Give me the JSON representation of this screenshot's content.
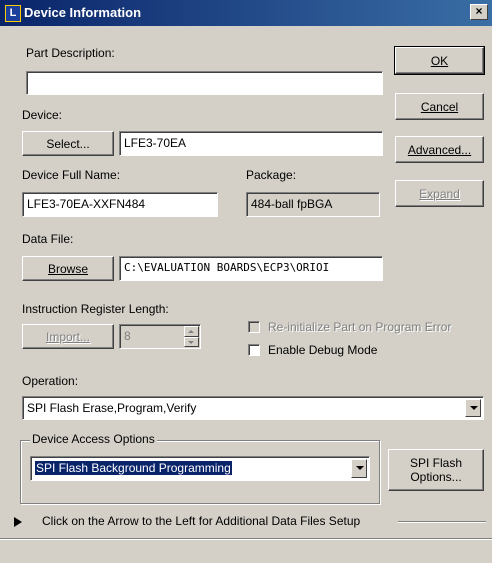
{
  "window": {
    "title": "Device Information",
    "close_glyph": "×"
  },
  "part_description": {
    "label": "Part Description:",
    "value": ""
  },
  "device": {
    "label": "Device:",
    "select_button": "Select...",
    "value": "LFE3-70EA"
  },
  "device_full_name": {
    "label": "Device Full Name:",
    "value": "LFE3-70EA-XXFN484"
  },
  "package": {
    "label": "Package:",
    "value": "484-ball fpBGA"
  },
  "data_file": {
    "label": "Data File:",
    "browse_button": "Browse",
    "value": "C:\\EVALUATION BOARDS\\ECP3\\ORIOI"
  },
  "instruction_register": {
    "label": "Instruction Register Length:",
    "import_button": "Import...",
    "value": "8"
  },
  "checkboxes": {
    "reinitialize": "Re-initialize Part on Program Error",
    "debug": "Enable Debug Mode"
  },
  "operation": {
    "label": "Operation:",
    "value": "SPI Flash Erase,Program,Verify"
  },
  "device_access": {
    "legend": "Device Access Options",
    "value": "SPI Flash Background Programming",
    "spi_button_line1": "SPI Flash",
    "spi_button_line2": "Options..."
  },
  "side_buttons": {
    "ok": "OK",
    "cancel": "Cancel",
    "advanced": "Advanced...",
    "expand": "Expand"
  },
  "footer": {
    "hint": "Click on the Arrow to the Left for Additional Data Files Setup"
  }
}
